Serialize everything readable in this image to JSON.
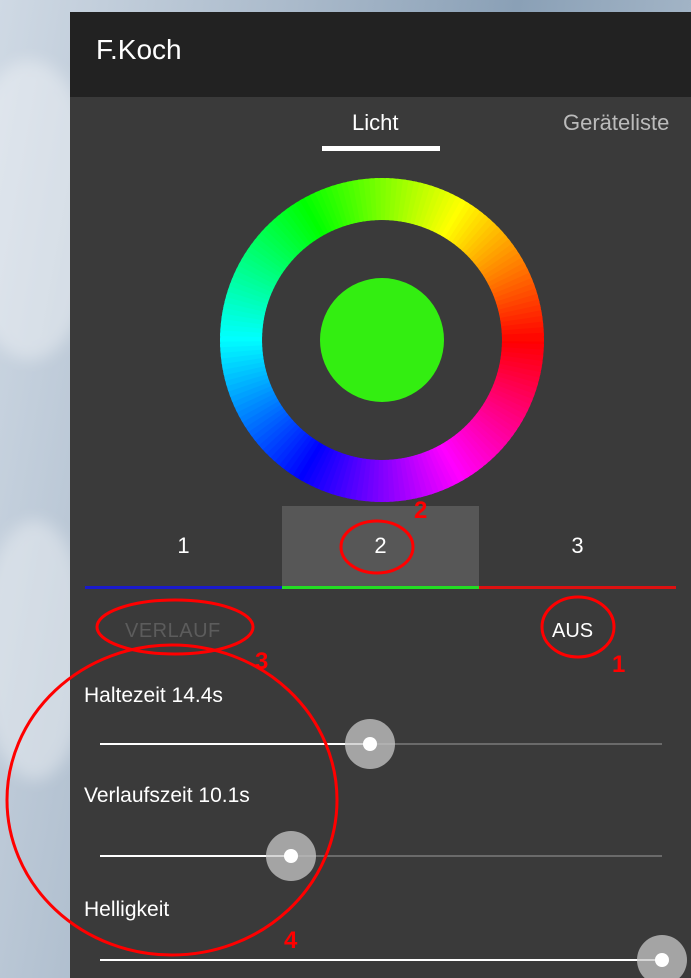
{
  "app": {
    "title": "F.Koch"
  },
  "tabs": [
    {
      "label": "Licht",
      "selected": true
    },
    {
      "label": "Geräteliste",
      "selected": false
    }
  ],
  "color_picker": {
    "selected_color": "#33ee11"
  },
  "channels": [
    {
      "label": "1",
      "color": "#1a1acc",
      "selected": false
    },
    {
      "label": "2",
      "color": "#22dd22",
      "selected": true
    },
    {
      "label": "3",
      "color": "#dd1111",
      "selected": false
    }
  ],
  "modes": {
    "verlauf_label": "VERLAUF",
    "aus_label": "AUS"
  },
  "sliders": [
    {
      "label": "Haltezeit 14.4s",
      "position": 0.48
    },
    {
      "label": "Verlaufszeit 10.1s",
      "position": 0.34
    },
    {
      "label": "Helligkeit",
      "position": 1.0
    }
  ],
  "annotations": {
    "color": "#ff0000",
    "numbers": [
      "1",
      "2",
      "3",
      "4"
    ]
  }
}
